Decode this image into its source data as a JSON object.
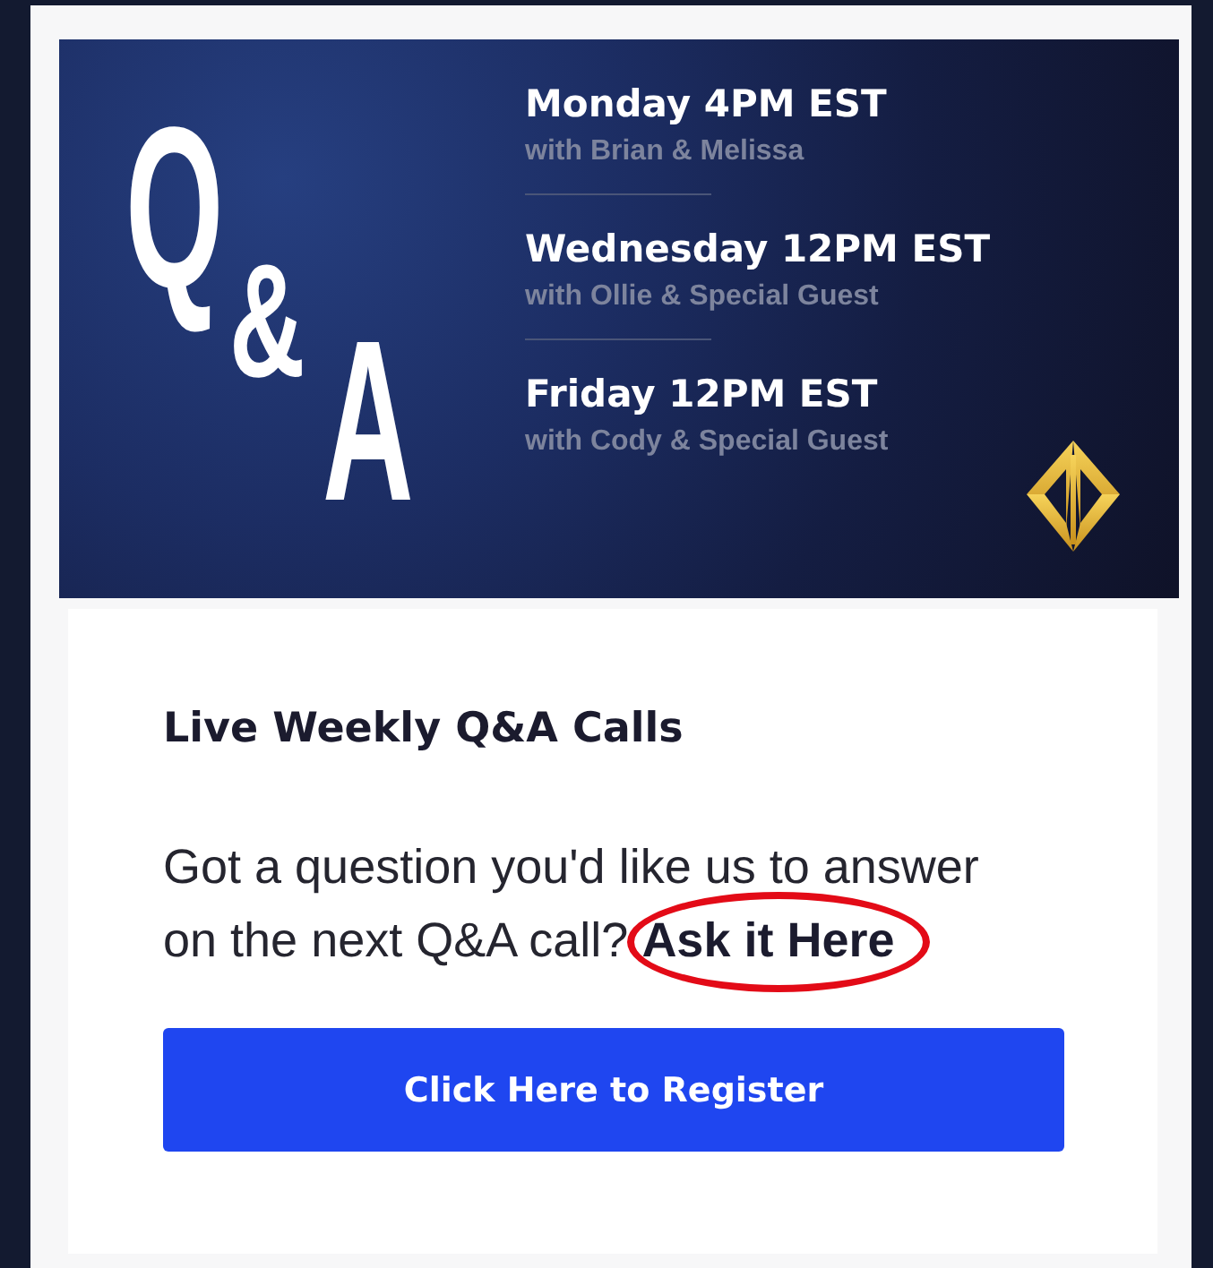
{
  "banner": {
    "title_letters": [
      "Q",
      "&",
      "A"
    ],
    "sessions": [
      {
        "time": "Monday 4PM EST",
        "hosts": "with Brian & Melissa"
      },
      {
        "time": "Wednesday 12PM EST",
        "hosts": "with Ollie & Special Guest"
      },
      {
        "time": "Friday 12PM EST",
        "hosts": "with Cody & Special Guest"
      }
    ]
  },
  "heading": "Live Weekly Q&A Calls",
  "description": {
    "text": "Got a question you'd like us to answer on the next Q&A call?",
    "link": "Ask it Here",
    "circled": true
  },
  "button": "Click Here to Register"
}
